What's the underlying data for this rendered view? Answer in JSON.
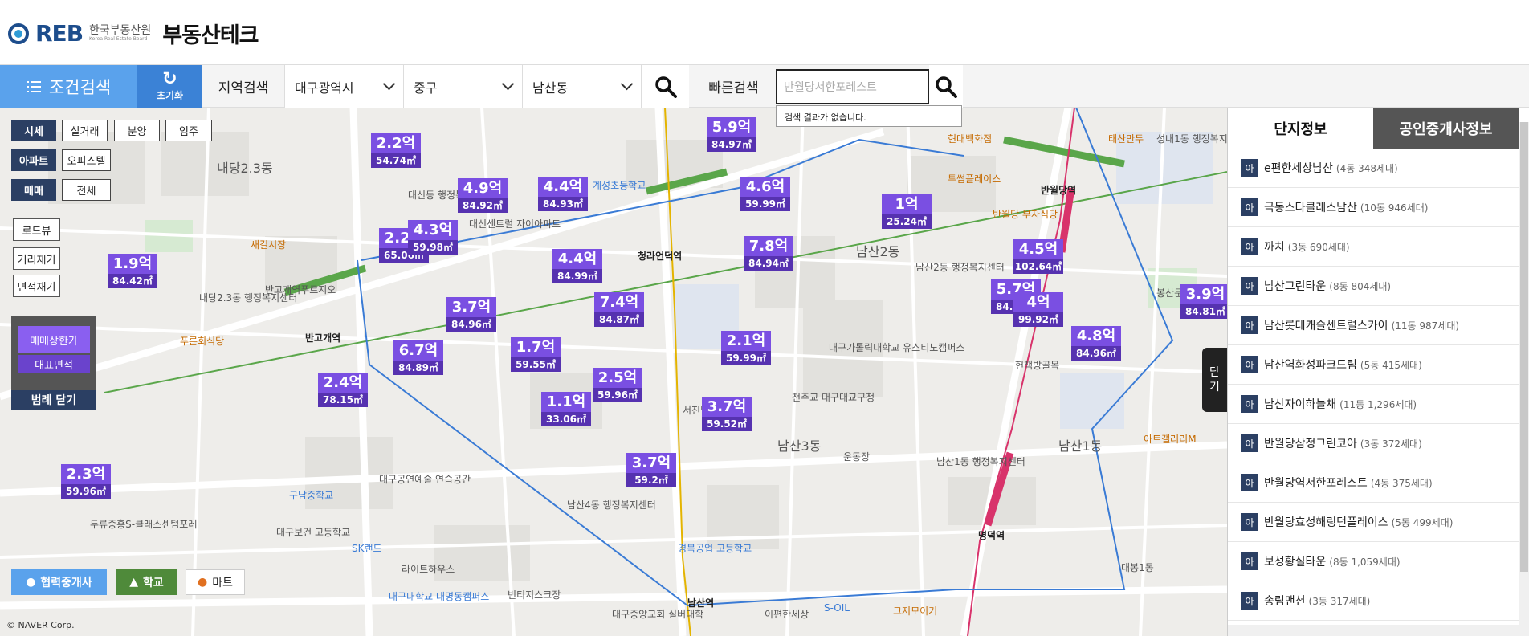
{
  "header": {
    "logo_text": "REB",
    "logo_org": "한국부동산원",
    "logo_org_en": "Korea Real Estate Board",
    "site_title": "부동산테크"
  },
  "toolbar": {
    "condition_search": "조건검색",
    "reset": "초기화",
    "region_search": "지역검색",
    "city": "대구광역시",
    "district": "중구",
    "dong": "남산동",
    "quick_search": "빠른검색",
    "quick_input_value": "반월당서한포레스트",
    "no_result": "검색 결과가 없습니다."
  },
  "legend": {
    "row1": [
      "시세",
      "실거래",
      "분양",
      "임주"
    ],
    "row2": [
      "아파트",
      "오피스텔"
    ],
    "row3": [
      "매매",
      "전세"
    ],
    "tools": [
      "로드뷰",
      "거리재기",
      "면적재기"
    ],
    "range_top": "매매상한가",
    "range_bottom": "대표면적",
    "range_close": "범례 닫기"
  },
  "bottom_buttons": {
    "agency": "협력중개사",
    "school": "학교",
    "mart": "마트"
  },
  "copyright": "© NAVER Corp.",
  "close_tab": [
    "닫",
    "기"
  ],
  "map": {
    "markers": [
      {
        "price": "2.2억",
        "area": "54.74㎡"
      },
      {
        "price": "4.9억",
        "area": "84.92㎡"
      },
      {
        "price": "4.4억",
        "area": "84.93㎡"
      },
      {
        "price": "5.9억",
        "area": "84.97㎡"
      },
      {
        "price": "4.6억",
        "area": "59.99㎡"
      },
      {
        "price": "1억",
        "area": "25.24㎡"
      },
      {
        "price": "2.2억",
        "area": "65.06㎡"
      },
      {
        "price": "4.3억",
        "area": "59.98㎡"
      },
      {
        "price": "1.9억",
        "area": "84.42㎡"
      },
      {
        "price": "4.4억",
        "area": "84.99㎡"
      },
      {
        "price": "7.8억",
        "area": "84.94㎡"
      },
      {
        "price": "4.5억",
        "area": "102.64㎡"
      },
      {
        "price": "3.9억",
        "area": "84.81㎡"
      },
      {
        "price": "3.7억",
        "area": "84.96㎡"
      },
      {
        "price": "7.4억",
        "area": "84.87㎡"
      },
      {
        "price": "5.7억",
        "area": "84.98㎡"
      },
      {
        "price": "4억",
        "area": "99.92㎡"
      },
      {
        "price": "6.7억",
        "area": "84.89㎡"
      },
      {
        "price": "1.7억",
        "area": "59.55㎡"
      },
      {
        "price": "2.1억",
        "area": "59.99㎡"
      },
      {
        "price": "4.8억",
        "area": "84.96㎡"
      },
      {
        "price": "2.4억",
        "area": "78.15㎡"
      },
      {
        "price": "2.5억",
        "area": "59.96㎡"
      },
      {
        "price": "1.1억",
        "area": "33.06㎡"
      },
      {
        "price": "3.7억",
        "area": "59.52㎡"
      },
      {
        "price": "3.7억",
        "area": "59.2㎡"
      },
      {
        "price": "2.3억",
        "area": "59.96㎡"
      }
    ],
    "labels": [
      "내당2.3동",
      "내당2.3동 행정복지센터",
      "반고개역",
      "반고개역푸르지오",
      "새길시장",
      "푸른회식당",
      "대신동 행정복지센터",
      "대신센트럴 자이아파트",
      "청라언덕역",
      "계성초등학교",
      "남산2동",
      "남산2동 행정복지센터",
      "반월당역",
      "반월당 부자식당",
      "현대백화점",
      "투썸플레이스",
      "남산3동",
      "천주교 대구대교구청",
      "대구가톨릭대학교 유스티노캠퍼스",
      "헌책방골목",
      "남산1동",
      "남산1동 행정복지센터",
      "명덕역",
      "대구공연예술 연습공간",
      "구남중학교",
      "대구보건 고등학교",
      "SK랜드",
      "라이트하우스",
      "대구대학교 대명동캠퍼스",
      "빈티지스크장",
      "남산4동 행정복지센터",
      "경북공업 고등학교",
      "남산역",
      "이편한세상",
      "봉산문화회관",
      "서진빌딩",
      "운동장",
      "아트갤러리M",
      "대봉1동",
      "태산만두",
      "성내1동 행정복지센터",
      "두류중흥S-클래스센텀포레",
      "S-OIL",
      "그저모이기",
      "대구중앙교회 실버대학"
    ]
  },
  "panel": {
    "tabs": [
      "단지정보",
      "공인중개사정보"
    ],
    "items": [
      {
        "tag": "아",
        "name": "e편한세상남산",
        "meta": "(4동 348세대)"
      },
      {
        "tag": "아",
        "name": "극동스타클래스남산",
        "meta": "(10동 946세대)"
      },
      {
        "tag": "아",
        "name": "까치",
        "meta": "(3동 690세대)"
      },
      {
        "tag": "아",
        "name": "남산그린타운",
        "meta": "(8동 804세대)"
      },
      {
        "tag": "아",
        "name": "남산롯데캐슬센트럴스카이",
        "meta": "(11동 987세대)"
      },
      {
        "tag": "아",
        "name": "남산역화성파크드림",
        "meta": "(5동 415세대)"
      },
      {
        "tag": "아",
        "name": "남산자이하늘채",
        "meta": "(11동 1,296세대)"
      },
      {
        "tag": "아",
        "name": "반월당삼정그린코아",
        "meta": "(3동 372세대)"
      },
      {
        "tag": "아",
        "name": "반월당역서한포레스트",
        "meta": "(4동 375세대)"
      },
      {
        "tag": "아",
        "name": "반월당효성해링턴플레이스",
        "meta": "(5동 499세대)"
      },
      {
        "tag": "아",
        "name": "보성황실타운",
        "meta": "(8동 1,059세대)"
      },
      {
        "tag": "아",
        "name": "송림맨션",
        "meta": "(3동 317세대)"
      }
    ]
  },
  "colors": {
    "marker": "#7a4fe2",
    "marker_area": "#5632b0",
    "toolbar_blue": "#5aa2ec",
    "navy": "#2b3f63"
  }
}
